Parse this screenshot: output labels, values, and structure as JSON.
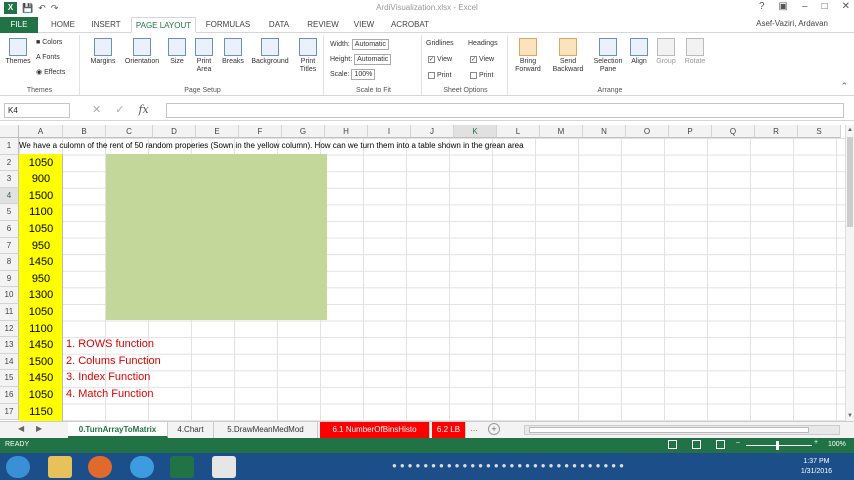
{
  "window": {
    "title": "ArdiVisualization.xlsx - Excel",
    "user": "Asef-Vaziri, Ardavan"
  },
  "tabs": [
    {
      "label": "FILE"
    },
    {
      "label": "HOME"
    },
    {
      "label": "INSERT"
    },
    {
      "label": "PAGE LAYOUT"
    },
    {
      "label": "FORMULAS"
    },
    {
      "label": "DATA"
    },
    {
      "label": "REVIEW"
    },
    {
      "label": "VIEW"
    },
    {
      "label": "ACROBAT"
    }
  ],
  "ribbon": {
    "themes": {
      "themes": "Themes",
      "colors": "Colors",
      "fonts": "Fonts",
      "effects": "Effects",
      "group": "Themes"
    },
    "page_setup": {
      "margins": "Margins",
      "orientation": "Orientation",
      "size": "Size",
      "print_area": "Print Area",
      "breaks": "Breaks",
      "background": "Background",
      "print_titles": "Print Titles",
      "group": "Page Setup"
    },
    "scale": {
      "width_label": "Width:",
      "width_value": "Automatic",
      "height_label": "Height:",
      "height_value": "Automatic",
      "scale_label": "Scale:",
      "scale_value": "100%",
      "group": "Scale to Fit"
    },
    "sheet_options": {
      "gridlines": "Gridlines",
      "headings": "Headings",
      "view": "View",
      "print": "Print",
      "group": "Sheet Options"
    },
    "arrange": {
      "bring_forward": "Bring Forward",
      "send_backward": "Send Backward",
      "selection_pane": "Selection Pane",
      "align": "Align",
      "group_btn": "Group",
      "rotate": "Rotate",
      "group": "Arrange"
    }
  },
  "formula_bar": {
    "name_box": "K4",
    "fx": "fx",
    "formula": ""
  },
  "columns": [
    "A",
    "B",
    "C",
    "D",
    "E",
    "F",
    "G",
    "H",
    "I",
    "J",
    "K",
    "L",
    "M",
    "N",
    "O",
    "P",
    "Q",
    "R",
    "S"
  ],
  "rows": [
    "1",
    "2",
    "3",
    "4",
    "5",
    "6",
    "7",
    "8",
    "9",
    "10",
    "11",
    "12",
    "13",
    "14",
    "15",
    "16",
    "17"
  ],
  "cells": {
    "note": "We have a culomn of the rent of 50 random properies (Sown in the yellow column). How can we turn them into a table shown in the grean area",
    "col_a": [
      "1050",
      "900",
      "1500",
      "1100",
      "1050",
      "950",
      "1450",
      "950",
      "1300",
      "1050",
      "1100",
      "1450",
      "1500",
      "1450",
      "1050",
      "1150"
    ],
    "functions": [
      "1. ROWS function",
      "2. Colums Function",
      "3. Index Function",
      "4. Match Function"
    ]
  },
  "sheets": [
    {
      "label": "0.TurnArrayToMatrix",
      "active": true
    },
    {
      "label": "4.Chart"
    },
    {
      "label": "5.DrawMeanMedMod"
    },
    {
      "label": "6.1 NumberOfBinsHisto",
      "red": true
    },
    {
      "label": "6.2 LB",
      "red": true
    }
  ],
  "status": {
    "state": "READY",
    "zoom": "100%"
  },
  "taskbar": {
    "time": "1:37 PM",
    "date": "1/31/2016"
  },
  "colors": {
    "excel_green": "#217346",
    "yellow": "#ffff00",
    "green_area": "#c4d79b",
    "red_text": "#e00000"
  }
}
